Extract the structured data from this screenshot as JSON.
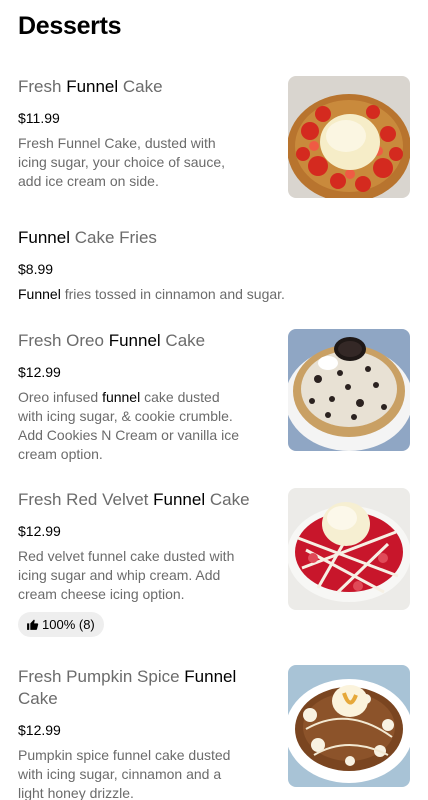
{
  "section": {
    "title": "Desserts"
  },
  "items": [
    {
      "name_parts": [
        "Fresh ",
        "Funnel",
        " Cake"
      ],
      "price": "$11.99",
      "desc_lines": [
        "Fresh Funnel Cake, dusted with",
        "icing sugar, your choice of sauce,",
        "add ice cream on side."
      ],
      "image": "funnel-cake-strawberry-icecream"
    },
    {
      "name_parts": [
        "Funnel",
        " Cake Fries"
      ],
      "price": "$8.99",
      "desc_parts": [
        "Funnel",
        " fries tossed in cinnamon and sugar."
      ]
    },
    {
      "name_parts": [
        "Fresh Oreo ",
        "Funnel",
        " Cake"
      ],
      "price": "$12.99",
      "desc_line1_parts": [
        "Oreo infused ",
        "funnel",
        " cake dusted"
      ],
      "desc_lines_rest": [
        "with icing sugar, & cookie crumble.",
        "Add Cookies N Cream or vanilla ice",
        "cream option."
      ],
      "image": "oreo-funnel-cake"
    },
    {
      "name_parts": [
        "Fresh Red Velvet ",
        "Funnel",
        " Cake"
      ],
      "price": "$12.99",
      "desc_lines": [
        "Red velvet funnel cake dusted with",
        "icing sugar and whip cream.  Add",
        "cream cheese icing option."
      ],
      "rating": "100% (8)",
      "image": "red-velvet-funnel-cake"
    },
    {
      "name_line1_parts": [
        "Fresh Pumpkin Spice ",
        "Funnel"
      ],
      "name_line2": "Cake",
      "price": "$12.99",
      "desc_lines": [
        "Pumpkin spice funnel cake dusted",
        "with icing sugar, cinnamon and a",
        "light honey drizzle."
      ],
      "image": "pumpkin-spice-funnel-cake"
    }
  ]
}
